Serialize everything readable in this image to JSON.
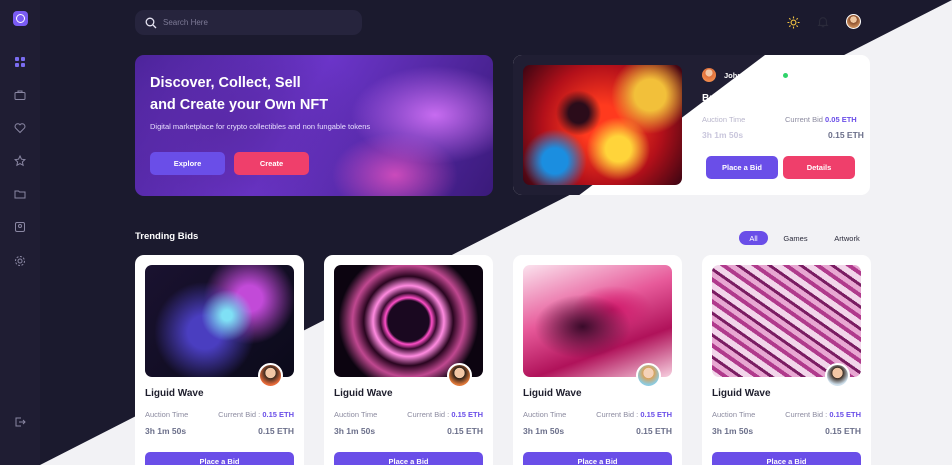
{
  "search": {
    "placeholder": "Search Here"
  },
  "header": {
    "theme_icon": "sun-icon",
    "notification_icon": "bell-icon",
    "avatar_icon": "user-avatar"
  },
  "sidebar": {
    "logo_icon": "app-logo-icon",
    "items": [
      {
        "icon": "grid-icon"
      },
      {
        "icon": "briefcase-icon"
      },
      {
        "icon": "heart-icon"
      },
      {
        "icon": "star-icon"
      },
      {
        "icon": "folder-icon"
      },
      {
        "icon": "profile-icon"
      },
      {
        "icon": "settings-icon"
      }
    ],
    "logout_icon": "logout-icon"
  },
  "hero": {
    "title_line1": "Discover, Collect, Sell",
    "title_line2": "and Create your Own NFT",
    "subtitle": "Digital marketplace for crypto collectibles and non fungable tokens",
    "explore_label": "Explore",
    "create_label": "Create"
  },
  "featured": {
    "author": "John Abraham",
    "title": "Brighten IQ",
    "auction_label": "Auction Time",
    "bid_label": "Current Bid",
    "bid_value": "0.05 ETH",
    "time": "3h 1m 50s",
    "price": "0.15 ETH",
    "bid_button": "Place a Bid",
    "details_button": "Details"
  },
  "trending": {
    "title": "Trending Bids",
    "filters": [
      "All",
      "Games",
      "Artwork"
    ]
  },
  "cards": [
    {
      "title": "Liguid Wave",
      "auction_label": "Auction Time",
      "bid_label": "Current Bid :",
      "bid_value": "0.15 ETH",
      "time": "3h 1m 50s",
      "price": "0.15 ETH",
      "button": "Place a Bid"
    },
    {
      "title": "Liguid Wave",
      "auction_label": "Auction Time",
      "bid_label": "Current Bid :",
      "bid_value": "0.15 ETH",
      "time": "3h 1m 50s",
      "price": "0.15 ETH",
      "button": "Place a Bid"
    },
    {
      "title": "Liguid Wave",
      "auction_label": "Auction Time",
      "bid_label": "Current Bid :",
      "bid_value": "0.15 ETH",
      "time": "3h 1m 50s",
      "price": "0.15 ETH",
      "button": "Place a Bid"
    },
    {
      "title": "Liguid Wave",
      "auction_label": "Auction Time",
      "bid_label": "Current Bid :",
      "bid_value": "0.15 ETH",
      "time": "3h 1m 50s",
      "price": "0.15 ETH",
      "button": "Place a Bid"
    }
  ],
  "colors": {
    "accent": "#6a4ee8",
    "pink": "#ef3f6b",
    "dark_bg": "#1b1a2e",
    "light_bg": "#f2f2f5"
  }
}
